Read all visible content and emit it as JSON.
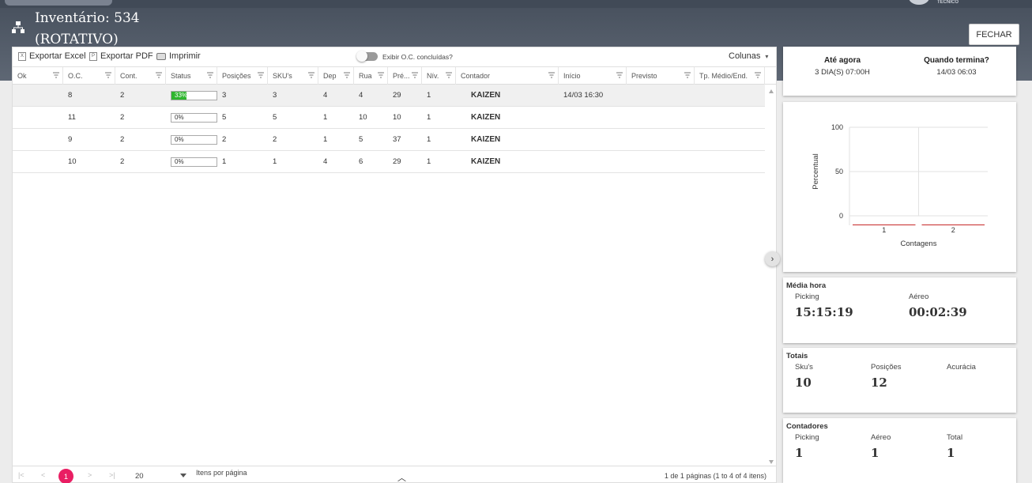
{
  "header": {
    "title_line1": "Inventário: 534",
    "title_line2": "(ROTATIVO)",
    "close_label": "FECHAR",
    "logo_subtitle": "TÉCNICO"
  },
  "toolbar": {
    "export_excel": "Exportar Excel",
    "export_pdf": "Exportar PDF",
    "print": "Imprimir",
    "toggle_label": "Exibir O.C. concluídas?",
    "columns": "Colunas"
  },
  "columns": [
    "Ok",
    "O.C.",
    "Cont.",
    "Status",
    "Posições",
    "SKU's",
    "Dep",
    "Rua",
    "Pré...",
    "Nív.",
    "Contador",
    "Início",
    "Previsto",
    "Tp. Médio/End."
  ],
  "rows": [
    {
      "ok": "",
      "oc": "8",
      "cont": "2",
      "status": "33%",
      "status_pct": 33,
      "posicoes": "3",
      "skus": "3",
      "dep": "4",
      "rua": "4",
      "pre": "29",
      "niv": "1",
      "contador": "KAIZEN",
      "inicio": "14/03 16:30",
      "previsto": "",
      "tp": ""
    },
    {
      "ok": "",
      "oc": "11",
      "cont": "2",
      "status": "0%",
      "status_pct": 0,
      "posicoes": "5",
      "skus": "5",
      "dep": "1",
      "rua": "10",
      "pre": "10",
      "niv": "1",
      "contador": "KAIZEN",
      "inicio": "",
      "previsto": "",
      "tp": ""
    },
    {
      "ok": "",
      "oc": "9",
      "cont": "2",
      "status": "0%",
      "status_pct": 0,
      "posicoes": "2",
      "skus": "2",
      "dep": "1",
      "rua": "5",
      "pre": "37",
      "niv": "1",
      "contador": "KAIZEN",
      "inicio": "",
      "previsto": "",
      "tp": ""
    },
    {
      "ok": "",
      "oc": "10",
      "cont": "2",
      "status": "0%",
      "status_pct": 0,
      "posicoes": "1",
      "skus": "1",
      "dep": "4",
      "rua": "6",
      "pre": "29",
      "niv": "1",
      "contador": "KAIZEN",
      "inicio": "",
      "previsto": "",
      "tp": ""
    }
  ],
  "pager": {
    "first": "|<",
    "prev": "<",
    "current_page": "1",
    "next": ">",
    "last": ">|",
    "page_size": "20",
    "page_size_label": "Itens por página",
    "info": "1 de 1 páginas (1 to 4 of 4 itens)"
  },
  "summary": {
    "elapsed_label": "Até agora",
    "elapsed_value": "3 DIA(S) 07:00H",
    "finish_label": "Quando termina?",
    "finish_value": "14/03 06:03"
  },
  "chart_data": {
    "type": "bar",
    "categories": [
      "1",
      "2"
    ],
    "values": [
      0,
      0
    ],
    "xlabel": "Contagens",
    "ylabel": "Percentual",
    "ylim": [
      0,
      100
    ],
    "yticks": [
      "0",
      "50",
      "100"
    ],
    "grid": true,
    "bar_color": "#c62828"
  },
  "media_hora": {
    "title": "Média hora",
    "picking_label": "Picking",
    "picking_value": "15:15:19",
    "aereo_label": "Aéreo",
    "aereo_value": "00:02:39"
  },
  "totais": {
    "title": "Totais",
    "skus_label": "Sku's",
    "skus_value": "10",
    "posicoes_label": "Posições",
    "posicoes_value": "12",
    "acuracia_label": "Acurácia",
    "acuracia_value": ""
  },
  "contadores": {
    "title": "Contadores",
    "picking_label": "Picking",
    "picking_value": "1",
    "aereo_label": "Aéreo",
    "aereo_value": "1",
    "total_label": "Total",
    "total_value": "1"
  },
  "colors": {
    "header_bg": "#49525f",
    "accent_pink": "#e91e63",
    "progress_green": "#2db52d"
  }
}
